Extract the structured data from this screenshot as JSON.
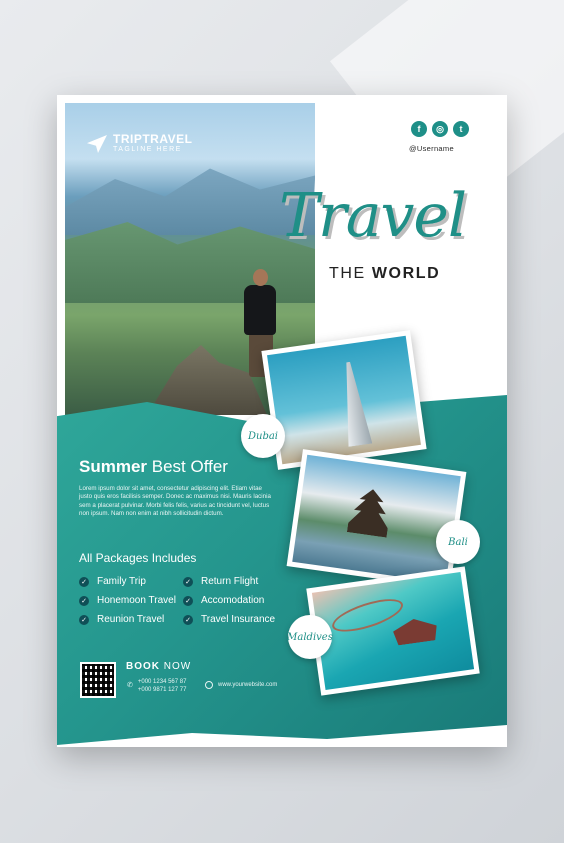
{
  "brand": {
    "name": "TRIPTRAVEL",
    "tagline": "TAGLINE HERE"
  },
  "social": {
    "icons": [
      "facebook-icon",
      "instagram-icon",
      "twitter-icon"
    ],
    "glyphs": [
      "f",
      "◎",
      "t"
    ],
    "username": "@Username"
  },
  "headline": {
    "script": "Travel",
    "sub_light": "THE ",
    "sub_bold": "WORLD"
  },
  "destinations": [
    "Dubai",
    "Bali",
    "Maldives"
  ],
  "offer": {
    "title_bold": "Summer",
    "title_rest": " Best Offer",
    "body": "Lorem ipsum dolor sit amet, consectetur adipiscing elit. Etiam vitae justo quis eros facilisis semper. Donec ac maximus nisi. Mauris lacinia sem a placerat pulvinar. Morbi felis felis, varius ac tincidunt vel, luctus non ipsum. Nam non enim at nibh sollicitudin dictum."
  },
  "packages": {
    "title": "All Packages Includes",
    "col1": [
      "Family Trip",
      "Honemoon Travel",
      "Reunion Travel"
    ],
    "col2": [
      "Return Flight",
      "Accomodation",
      "Travel Insurance"
    ]
  },
  "contact": {
    "book_bold": "BOOK",
    "book_rest": " NOW",
    "phone1": "+000 1234 567 87",
    "phone2": "+000 9871 127 77",
    "website": "www.yourwebsite.com"
  },
  "colors": {
    "teal": "#1f8f87",
    "teal_dark": "#197a78",
    "check_bg": "#0f4f57"
  }
}
